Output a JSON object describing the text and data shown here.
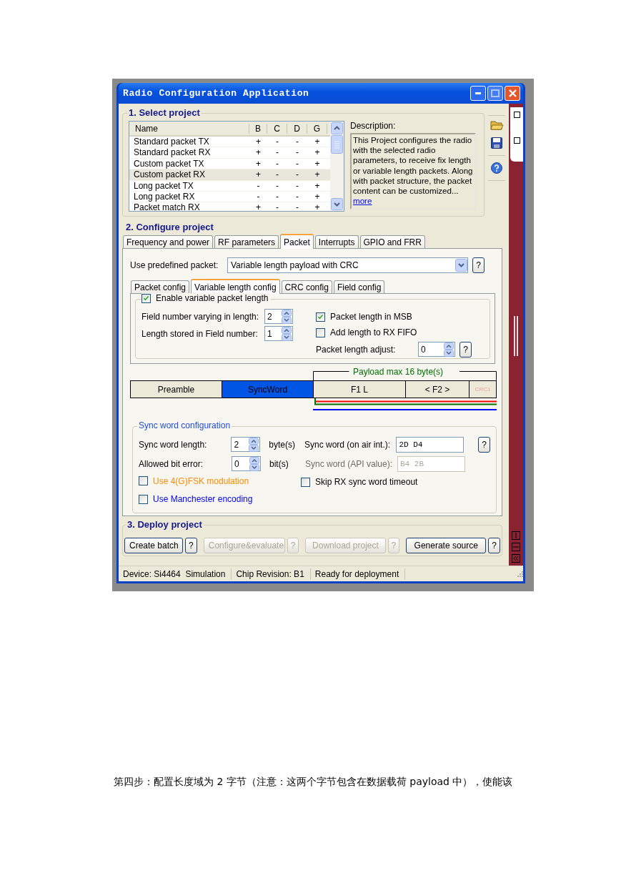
{
  "window": {
    "title": "Radio Configuration Application"
  },
  "select_project": {
    "heading": "1. Select project",
    "columns": [
      "Name",
      "B",
      "C",
      "D",
      "G"
    ],
    "rows": [
      {
        "cells": [
          "Standard packet TX",
          "+",
          "-",
          "-",
          "+"
        ],
        "selected": false
      },
      {
        "cells": [
          "Standard packet RX",
          "+",
          "-",
          "-",
          "+"
        ],
        "selected": false
      },
      {
        "cells": [
          "Custom packet TX",
          "+",
          "-",
          "-",
          "+"
        ],
        "selected": false
      },
      {
        "cells": [
          "Custom packet RX",
          "+",
          "-",
          "-",
          "+"
        ],
        "selected": true
      },
      {
        "cells": [
          "Long packet TX",
          "-",
          "-",
          "-",
          "+"
        ],
        "selected": false
      },
      {
        "cells": [
          "Long packet RX",
          "-",
          "-",
          "-",
          "+"
        ],
        "selected": false
      },
      {
        "cells": [
          "Packet match RX",
          "+",
          "-",
          "-",
          "+"
        ],
        "selected": false
      }
    ],
    "description_label": "Description:",
    "description": "This Project configures the radio with the selected radio parameters, to receive fix length or variable length packets. Along with packet structure, the packet content can be customized... ",
    "more_link": "more"
  },
  "configure_project": {
    "heading": "2. Configure project",
    "tabs": [
      {
        "label": "Frequency and power",
        "selected": false
      },
      {
        "label": "RF parameters",
        "selected": false
      },
      {
        "label": "Packet",
        "selected": true
      },
      {
        "label": "Interrupts",
        "selected": false
      },
      {
        "label": "GPIO and FRR",
        "selected": false
      }
    ],
    "predefined_label": "Use predefined packet:",
    "predefined_value": "Variable length payload with CRC",
    "predefined_help": "?",
    "sub_tabs": [
      {
        "label": "Packet config",
        "selected": false
      },
      {
        "label": "Variable length config",
        "selected": true
      },
      {
        "label": "CRC config",
        "selected": false
      },
      {
        "label": "Field config",
        "selected": false
      }
    ],
    "enable_variable_length": {
      "label": "Enable variable packet length",
      "checked": true
    },
    "field_number": {
      "label": "Field number varying in length:",
      "value": "2"
    },
    "length_field": {
      "label": "Length stored in Field number:",
      "value": "1"
    },
    "length_in_msb": {
      "label": "Packet length in MSB",
      "checked": true
    },
    "add_length_to_fifo": {
      "label": "Add length to RX FIFO",
      "checked": false
    },
    "length_adjust": {
      "label": "Packet length adjust:",
      "value": "0",
      "help": "?"
    }
  },
  "packet_diagram": {
    "payload_label": "Payload max 16 byte(s)",
    "segments": [
      {
        "label": "Preamble",
        "kind": "plain"
      },
      {
        "label": "SyncWord",
        "kind": "highlighted"
      },
      {
        "label": "F1 L",
        "kind": "plain"
      },
      {
        "label": "< F2 >",
        "kind": "plain"
      },
      {
        "label": "CRC1",
        "kind": "faded"
      }
    ]
  },
  "sync_word": {
    "heading": "Sync word configuration",
    "length": {
      "label": "Sync word length:",
      "value": "2",
      "unit": "byte(s)"
    },
    "bit_error": {
      "label": "Allowed bit error:",
      "value": "0",
      "unit": "bit(s)"
    },
    "on_air": {
      "label": "Sync word (on air int.):",
      "value": "2D D4",
      "disabled": false,
      "help": "?"
    },
    "api_value": {
      "label": "Sync word (API value):",
      "value": "B4 2B",
      "disabled": true
    },
    "options": [
      {
        "label": "Use 4(G)FSK modulation",
        "checked": false,
        "color": "#ff8c00"
      },
      {
        "label": "Skip RX sync word timeout",
        "checked": false,
        "color": "#000000"
      },
      {
        "label": "Use Manchester encoding",
        "checked": false,
        "color": "#0000ff"
      }
    ]
  },
  "deploy": {
    "heading": "3. Deploy project",
    "buttons": [
      {
        "label": "Create batch",
        "disabled": false,
        "help": "?"
      },
      {
        "label": "Configure&evaluate",
        "disabled": true,
        "help": "?"
      },
      {
        "label": "Download project",
        "disabled": true,
        "help": "?"
      },
      {
        "label": "Generate source",
        "disabled": false,
        "help": "?"
      }
    ]
  },
  "status_bar": [
    "Device: Si4464  Simulation",
    "Chip Revision: B1",
    "Ready for deployment"
  ],
  "caption": "第四步：配置长度域为 2 字节（注意：这两个字节包含在数据载荷 payload 中），使能该"
}
